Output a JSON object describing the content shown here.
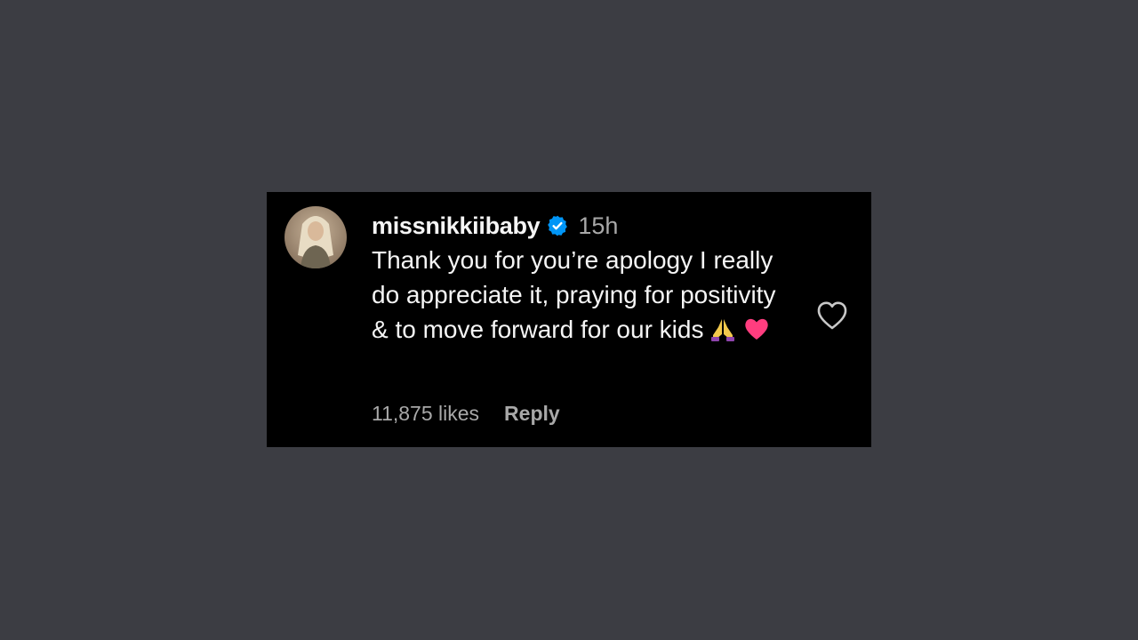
{
  "comment": {
    "username": "missnikkiibaby",
    "timestamp": "15h",
    "text": "Thank you for you’re apology I really do appreciate it, praying for positivity & to move forward for our kids",
    "emojis": [
      "folded-hands",
      "pink-heart"
    ],
    "likes": "11,875 likes",
    "reply_label": "Reply",
    "verified": true
  },
  "colors": {
    "background": "#3c3d43",
    "card": "#000000",
    "text_primary": "#f5f5f5",
    "text_secondary": "#a8a8a8",
    "verified_badge": "#0095f6"
  },
  "icons": {
    "verified": "verified-badge-icon",
    "like": "heart-outline-icon"
  }
}
